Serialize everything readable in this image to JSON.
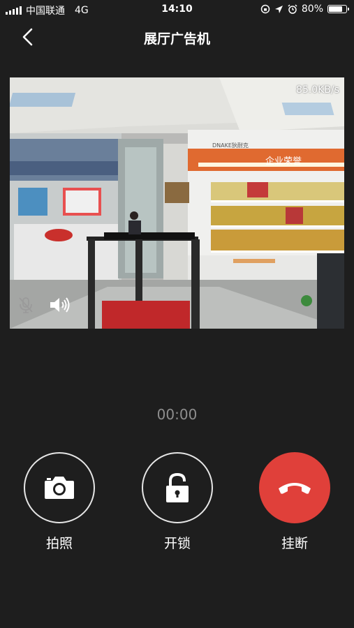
{
  "status_bar": {
    "carrier": "中国联通",
    "network": "4G",
    "time": "14:10",
    "battery": "80%",
    "battery_level": 0.8
  },
  "nav": {
    "title": "展厅广告机"
  },
  "video": {
    "bitrate": "85.0KB/s",
    "scene": {
      "banner_text": "企业荣誉",
      "brand_text": "DNAKE狄耐克"
    }
  },
  "call": {
    "timer": "00:00"
  },
  "actions": {
    "photo_label": "拍照",
    "unlock_label": "开锁",
    "hangup_label": "挂断"
  },
  "colors": {
    "background": "#1e1e1e",
    "hangup": "#e0403a",
    "timer": "#8e8e8e"
  }
}
